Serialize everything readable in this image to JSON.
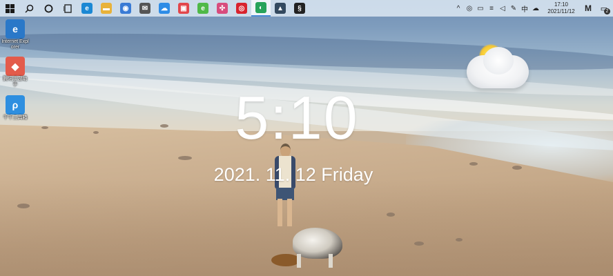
{
  "taskbar": {
    "start_icon": "windows-logo-icon",
    "search_icon": "search-icon",
    "cortana_icon": "cortana-circle-icon",
    "taskview_icon": "task-view-icon",
    "apps": [
      {
        "name": "edge-icon",
        "glyph": "e",
        "color": "#1b88d4",
        "active": false
      },
      {
        "name": "file-explorer-icon",
        "glyph": "▬",
        "color": "#e8b23a",
        "active": false
      },
      {
        "name": "browser-globe-icon",
        "glyph": "◉",
        "color": "#3a7bd5",
        "active": false
      },
      {
        "name": "mail-icon",
        "glyph": "✉",
        "color": "#555555",
        "active": false
      },
      {
        "name": "cloud-drive-icon",
        "glyph": "☁",
        "color": "#2d8ce6",
        "active": false
      },
      {
        "name": "red-app-icon",
        "glyph": "▣",
        "color": "#e2474b",
        "active": false
      },
      {
        "name": "360-browser-icon",
        "glyph": "e",
        "color": "#4fb948",
        "active": false
      },
      {
        "name": "pinwheel-app-icon",
        "glyph": "✣",
        "color": "#d84c7d",
        "active": false
      },
      {
        "name": "netease-music-icon",
        "glyph": "◎",
        "color": "#d8232e",
        "active": false
      },
      {
        "name": "green-chat-icon",
        "glyph": "◐",
        "color": "#27a35a",
        "active": true
      },
      {
        "name": "photos-icon",
        "glyph": "▲",
        "color": "#33495f",
        "active": false
      },
      {
        "name": "swirl-app-icon",
        "glyph": "§",
        "color": "#222222",
        "active": false
      }
    ],
    "tray_icons": [
      {
        "name": "chevron-up-icon",
        "glyph": "^"
      },
      {
        "name": "netease-tray-icon",
        "glyph": "◎"
      },
      {
        "name": "battery-icon",
        "glyph": "▭"
      },
      {
        "name": "network-icon",
        "glyph": "≡"
      },
      {
        "name": "volume-icon",
        "glyph": "◁"
      },
      {
        "name": "pen-icon",
        "glyph": "✎"
      },
      {
        "name": "language-icon",
        "glyph": "中"
      },
      {
        "name": "cloud-sync-icon",
        "glyph": "☁"
      }
    ],
    "clock_time": "17:10",
    "clock_date": "2021/11/12",
    "extra_tray_label": "M",
    "notification_count": "2"
  },
  "desktop_icons": [
    {
      "name": "internet-explorer-icon",
      "glyph": "e",
      "color": "#2a78c8",
      "label": "Internet Explorer"
    },
    {
      "name": "game-app-icon",
      "glyph": "◆",
      "color": "#e35b4b",
      "label": "腾讯手游助手"
    },
    {
      "name": "blue-tool-icon",
      "glyph": "ρ",
      "color": "#2e8fe0",
      "label": "千千工具箱"
    }
  ],
  "widget": {
    "time": "5:10",
    "date": "2021. 11. 12  Friday",
    "weather_icon": "partly-cloudy-weather-icon"
  }
}
